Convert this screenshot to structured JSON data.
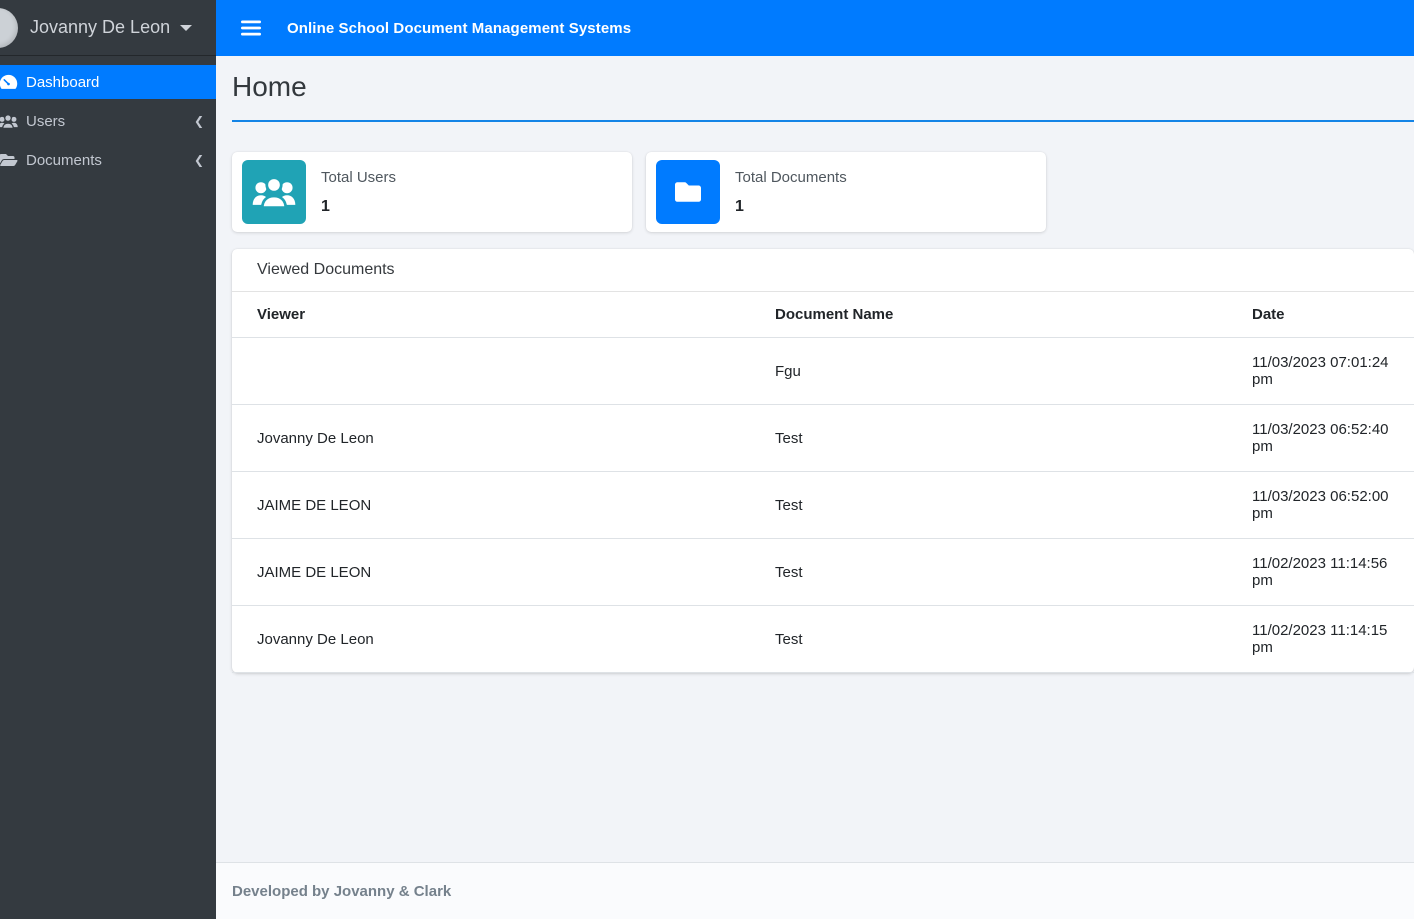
{
  "sidebar": {
    "user": {
      "name": "Jovanny De Leon"
    },
    "items": [
      {
        "label": "Dashboard",
        "icon": "tachometer-icon",
        "active": true
      },
      {
        "label": "Users",
        "icon": "users-icon",
        "chevron": "❮"
      },
      {
        "label": "Documents",
        "icon": "folder-open-icon",
        "chevron": "❮"
      }
    ]
  },
  "topbar": {
    "title": "Online School Document Management Systems",
    "menu_icon": "hamburger-icon"
  },
  "page": {
    "heading": "Home"
  },
  "stats": [
    {
      "label": "Total Users",
      "value": "1",
      "icon": "users-icon",
      "icon_bg": "#20a3b5"
    },
    {
      "label": "Total Documents",
      "value": "1",
      "icon": "folder-icon",
      "icon_bg": "#007bff"
    }
  ],
  "viewed_documents": {
    "title": "Viewed Documents",
    "columns": [
      "Viewer",
      "Document Name",
      "Date"
    ],
    "rows": [
      {
        "viewer": "",
        "document": "Fgu",
        "date": "11/03/2023 07:01:24 pm"
      },
      {
        "viewer": "Jovanny De Leon",
        "document": "Test",
        "date": "11/03/2023 06:52:40 pm"
      },
      {
        "viewer": "JAIME DE LEON",
        "document": "Test",
        "date": "11/03/2023 06:52:00 pm"
      },
      {
        "viewer": "JAIME DE LEON",
        "document": "Test",
        "date": "11/02/2023 11:14:56 pm"
      },
      {
        "viewer": "Jovanny De Leon",
        "document": "Test",
        "date": "11/02/2023 11:14:15 pm"
      }
    ]
  },
  "footer": {
    "text": "Developed by Jovanny & Clark"
  },
  "colors": {
    "topbar": "#007bff",
    "sidebar_bg": "#343a40",
    "active_item": "#007bff",
    "content_bg": "#f2f4f8",
    "header_rule": "#1484e6",
    "stat_users_bg": "#20a3b5",
    "stat_docs_bg": "#007bff"
  }
}
